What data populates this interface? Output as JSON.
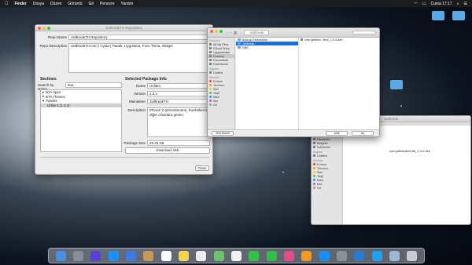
{
  "menubar": {
    "apple": "",
    "app": "Finder",
    "items": [
      "Dosya",
      "Düzen",
      "Görüntü",
      "Git",
      "Pencere",
      "Yardım"
    ],
    "clock": "Cuma 17:17"
  },
  "main_window": {
    "title": "JailbreakTH Repository",
    "repo_name_label": "Repo Name",
    "repo_name": "JailbreakTH Repository",
    "repo_desc_label": "Repo Description",
    "repo_desc": "JailbreakTH.com | Cydia | Tweak, Uygulama, Font, Tema, Widget",
    "sections_header": "Sections",
    "search_label": "Search by Name",
    "search_value": "bna",
    "tree": [
      {
        "label": "BYA Apps",
        "expanded": false
      },
      {
        "label": "BYA Themes",
        "expanded": false
      },
      {
        "label": "Tweaks",
        "expanded": true
      },
      {
        "label": "Unlite-1 (1.3.4)",
        "selected": true
      }
    ],
    "selected_header": "Selected Package Info",
    "name_label": "Name",
    "name": "Unlite4",
    "version_label": "Version",
    "version": "1.3.4",
    "maintainer_label": "Maintainer",
    "maintainer": "JailbreakTH",
    "desc_label": "Description",
    "desc": "iPhone X göründümünü, hazılatlarını diğer cihazlara getirin.",
    "size_label": "Package Size",
    "size": "28.30 KB",
    "download": "Download .deb",
    "close": "Close"
  },
  "finder1": {
    "title": "Jailbreak",
    "sidebar": [
      {
        "head": "Favoriler"
      },
      {
        "label": "All My Files"
      },
      {
        "label": "iCloud Drive"
      },
      {
        "label": "Uygulamalar"
      },
      {
        "label": "Desktop",
        "sel": true
      },
      {
        "label": "Documents"
      },
      {
        "label": "Downloads"
      },
      {
        "head": "Aygıtlar"
      },
      {
        "label": "Unitled"
      },
      {
        "head": "Etiketler"
      },
      {
        "label": "Kırmızı",
        "color": "#e0443e"
      },
      {
        "label": "Turuncu",
        "color": "#f39a2b"
      },
      {
        "label": "Sarı",
        "color": "#f5cf2f"
      },
      {
        "label": "Yeşil",
        "color": "#5fc043"
      },
      {
        "label": "Mavi",
        "color": "#2f8ff0"
      },
      {
        "label": "Mor",
        "color": "#b45ad6"
      },
      {
        "label": "Gri",
        "color": "#9a9a9a"
      }
    ],
    "col1": [
      {
        "label": "Barkup Extensions"
      },
      {
        "label": "Jailbreak",
        "sel": true
      },
      {
        "label": "DBX"
      }
    ],
    "col2": [
      {
        "label": "com.jailbrea...lite4_1.3.4.deb"
      }
    ],
    "cancel": "Yeni Klasör",
    "open": "İptal",
    "ok": "Aç"
  },
  "finder2": {
    "title": "Jailbreak",
    "sidebar": [
      {
        "label": "Tüm Dosyalarım"
      },
      {
        "label": "iCloud Drive"
      },
      {
        "label": "Uygulamalar"
      },
      {
        "label": "Masaüstü"
      },
      {
        "label": "Belgeler"
      },
      {
        "label": "İndirilenler"
      },
      {
        "head": "Aygıtlar"
      },
      {
        "label": "Untitled"
      },
      {
        "head": "Etiketler"
      },
      {
        "label": "Kırmızı",
        "color": "#e0443e"
      },
      {
        "label": "Turuncu",
        "color": "#f39a2b"
      },
      {
        "label": "Sarı",
        "color": "#f5cf2f"
      },
      {
        "label": "Yeşil",
        "color": "#5fc043"
      },
      {
        "label": "Mavi",
        "color": "#2f8ff0"
      },
      {
        "label": "Mor",
        "color": "#b45ad6"
      },
      {
        "label": "Gri",
        "color": "#9a9a9a"
      }
    ],
    "file": "com.jailbreakth.lite_1.3.4.deb"
  },
  "desktop_icons": [
    {
      "label": "",
      "color": "#5aa9e6"
    },
    {
      "label": "",
      "color": "#5aa9e6"
    },
    {
      "label": "",
      "color": "#5aa9e6"
    }
  ],
  "dock": [
    "finder",
    "launchpad",
    "siri",
    "safari",
    "mail",
    "contacts",
    "calendar",
    "notes",
    "reminders",
    "maps",
    "photos",
    "messages",
    "facetime",
    "itunes",
    "ibooks",
    "app-store",
    "preferences",
    "xcode",
    "twitter",
    "preview",
    "trash"
  ]
}
